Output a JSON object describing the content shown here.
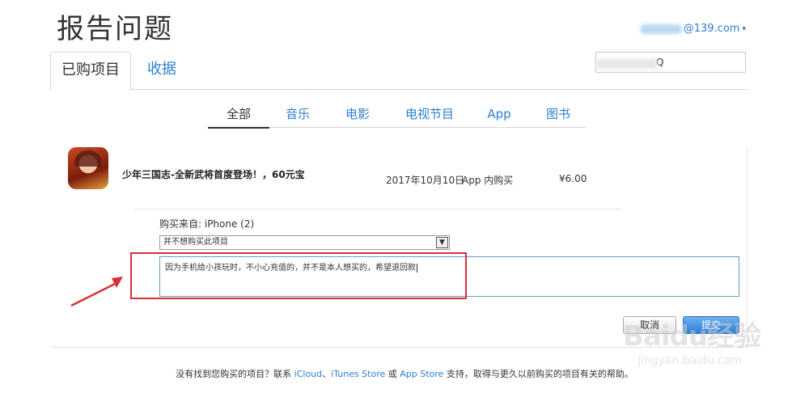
{
  "header": {
    "title": "报告问题",
    "account": "@139.com"
  },
  "tabs": [
    {
      "label": "已购项目"
    },
    {
      "label": "收据"
    }
  ],
  "search": {
    "value": "Q"
  },
  "filters": [
    "全部",
    "音乐",
    "电影",
    "电视节目",
    "App",
    "图书"
  ],
  "item": {
    "name": "少年三国志-全新武将首度登场！，60元宝",
    "date": "2017年10月10日",
    "type": "App 内购买",
    "price": "¥6.00"
  },
  "form": {
    "from_label": "购买来自: iPhone (2)",
    "reason": "并不想购买此项目",
    "comment": "因为手机给小孩玩时，不小心充值的，并不是本人想买的，希望退回款",
    "cancel": "取消",
    "submit": "提交"
  },
  "footer": {
    "prefix": "没有找到您购买的项目？联系 ",
    "icloud": "iCloud",
    "sep1": "、",
    "itunes": "iTunes Store",
    "or": " 或 ",
    "appstore": "App Store",
    "suffix": " 支持，取得与更久以前购买的项目有关的帮助。"
  },
  "watermark": {
    "main": "Baidu经验",
    "sub": "jingyan.baidu.com"
  },
  "colors": {
    "link": "#2d7fd3",
    "highlight": "#d8303a"
  }
}
